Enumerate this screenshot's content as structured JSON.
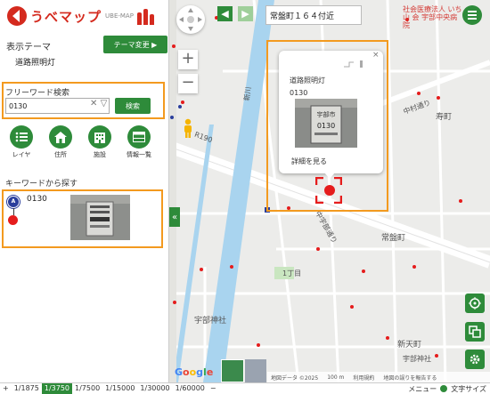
{
  "logo": {
    "text": "うべマップ",
    "sub": "UBE-MAP"
  },
  "theme": {
    "label": "表示テーマ",
    "change_button": "テーマ変更 ▶",
    "current": "道路照明灯"
  },
  "freeword": {
    "label": "フリーワード検索",
    "value": "0130",
    "clear_icon": "✕",
    "dropdown_icon": "▽",
    "search_button": "検索"
  },
  "tools": [
    {
      "label": "レイヤ",
      "icon": "list-icon"
    },
    {
      "label": "住所",
      "icon": "home-icon"
    },
    {
      "label": "施設",
      "icon": "building-icon"
    },
    {
      "label": "情報一覧",
      "icon": "table-icon"
    }
  ],
  "keyword_results": {
    "label": "キーワードから探す",
    "items": [
      {
        "pin_label": "A",
        "code": "0130"
      }
    ]
  },
  "map": {
    "address_box": "常盤町１６４付近",
    "labels": {
      "jinja": "宇部神社",
      "road190": "R190",
      "tokiwa": "常盤町",
      "itchome": "1丁目",
      "kotobuki": "寿町",
      "shintenchi": "新天町",
      "ekimae": "駅前",
      "nakamura": "中村通り",
      "hospital": "社会医療法人 いち 山 会 宇部中央病院",
      "nakauchi": "中宇部通り",
      "ubejinja_street": "宇部神社",
      "shinkawa": "新川",
      "toyo": "宇部興業",
      "chuo": "中央",
      "sanno": "寿町",
      "shintenchi2": "新天町"
    },
    "popup": {
      "title": "道路照明灯",
      "code": "0130",
      "link": "詳細を見る",
      "close": "×",
      "sign_city": "宇部市",
      "sign_code": "0130"
    },
    "google": [
      "G",
      "o",
      "o",
      "g",
      "l",
      "e"
    ],
    "attribution": [
      "地図データ ©2025",
      "100 m",
      "利用規約",
      "地図の誤りを報告する"
    ]
  },
  "scale": {
    "items": [
      "+",
      "1/1875",
      "1/3750",
      "1/7500",
      "1/15000",
      "1/30000",
      "1/60000",
      "−"
    ],
    "active_index": 2,
    "right_menu": "メニュー",
    "right_size": "文字サイズ"
  },
  "colors": {
    "accent": "#2e8b3a",
    "highlight": "#f39a1f",
    "marker": "#e51c1c",
    "brand": "#d42a1e"
  }
}
